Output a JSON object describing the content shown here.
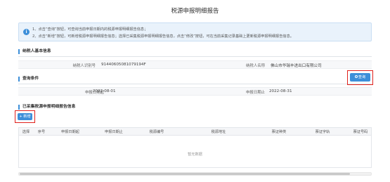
{
  "page": {
    "title": "税源申报明细报告"
  },
  "notice": {
    "icon": "info-icon",
    "line1": "1、点击“查询”按钮，可查询当前申报日期内的税源申报明细报告信息；",
    "line2": "2、点击“新增”按钮，可新增税源申报明细报告信息；选择已采集税源申报明细报告信息，点击“修改”按钮，可在当前采集记录基础上更新税源申报明细报告信息。"
  },
  "taxpayer": {
    "section_title": "纳税人基本信息",
    "id_label": "纳税人识别号",
    "id_value": "91440605081079194F",
    "name_label": "纳税人名称",
    "name_value": "佛山市华瑞丰进出口有限公司"
  },
  "query": {
    "section_title": "查询条件",
    "start_label": "申报日期起",
    "start_value": "2022-08-01",
    "end_label": "申报日期止",
    "end_value": "2022-08-31",
    "query_button": "查询"
  },
  "collected": {
    "section_title": "已采集税源申报明细报告信息",
    "add_button": "+ 新增",
    "columns": [
      "选择",
      "序号",
      "申报日期起",
      "申报日期止",
      "税源编号",
      "税源地址",
      "票证种类",
      "票证字轨",
      "票证号码"
    ],
    "empty_text": "暂无数据"
  }
}
